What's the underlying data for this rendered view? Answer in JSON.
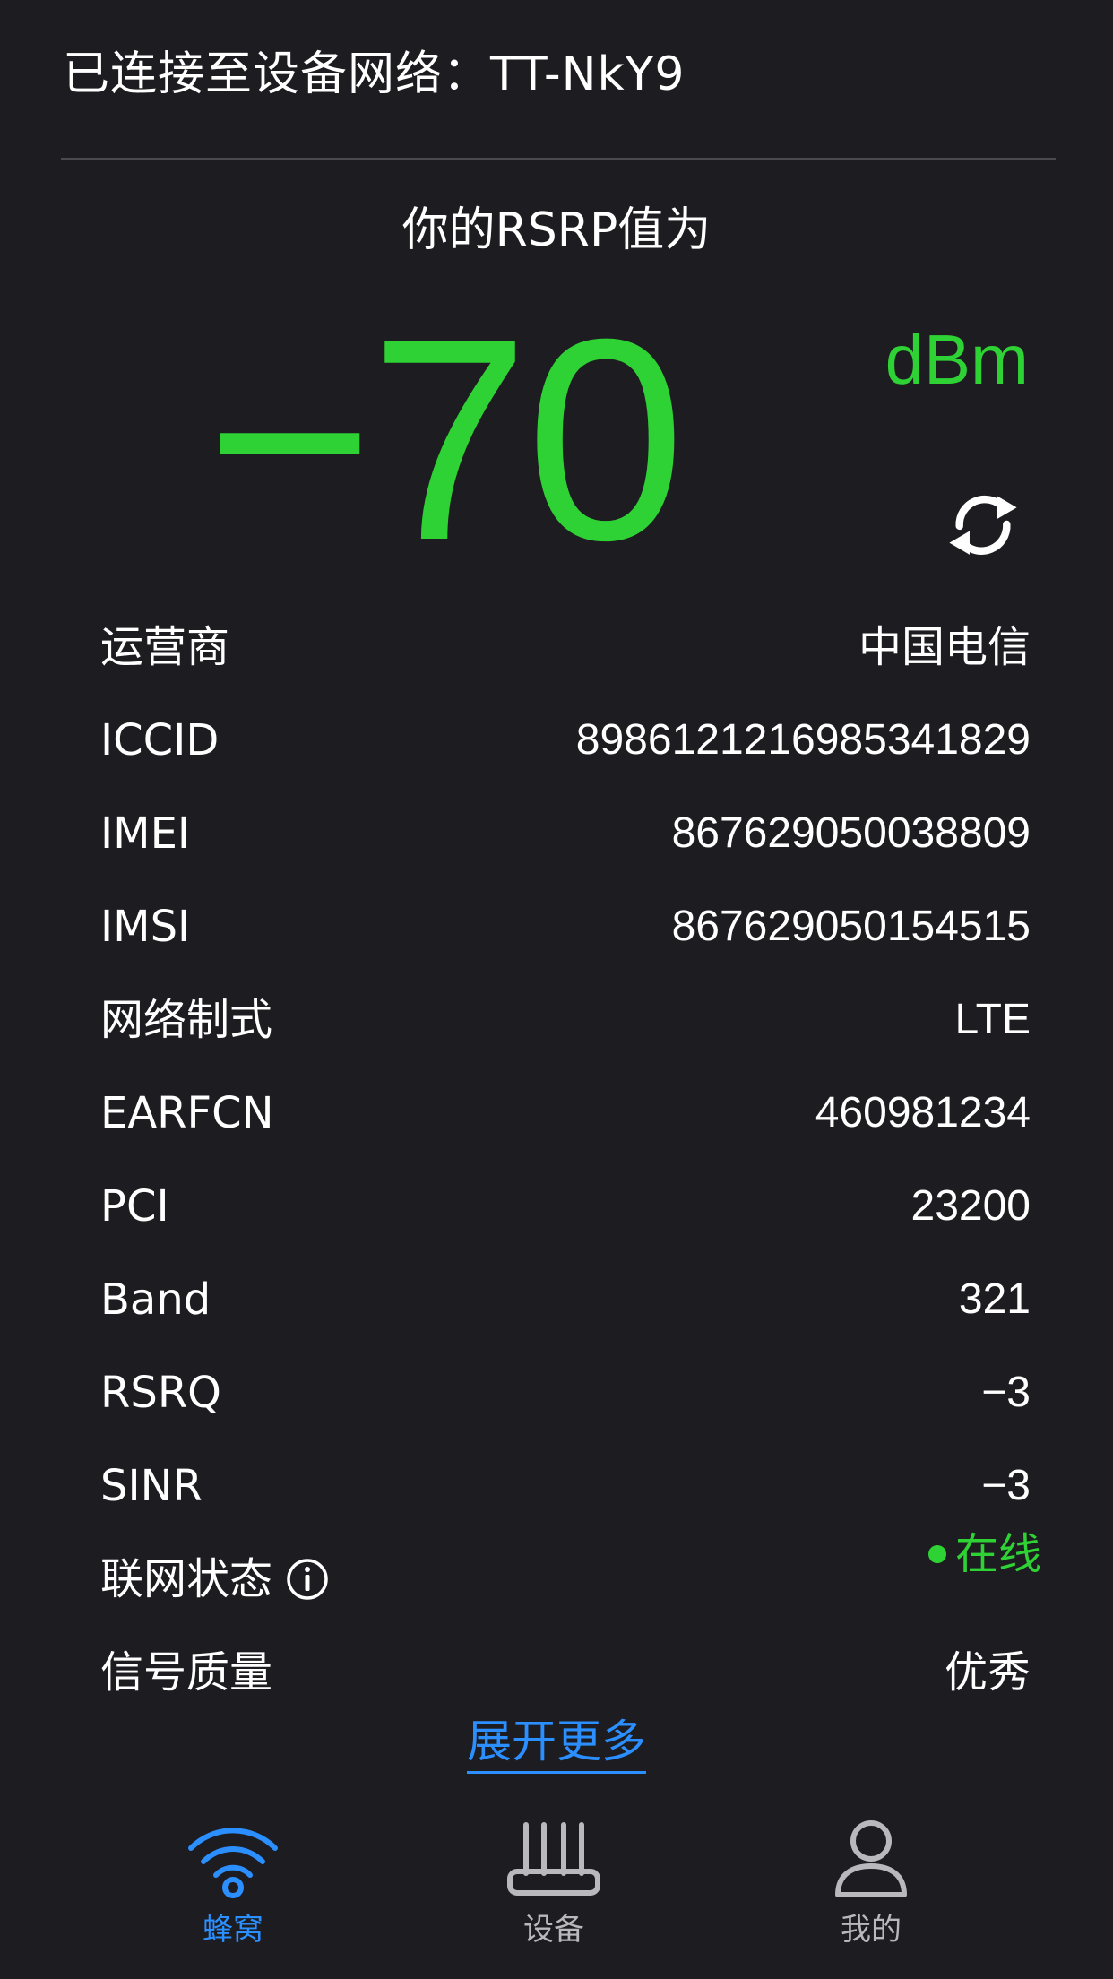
{
  "header": {
    "title": "已连接至设备网络：TT-NkY9"
  },
  "rsrp": {
    "label": "你的RSRP值为",
    "value": "−70",
    "unit": "dBm",
    "refresh_icon": "refresh-icon"
  },
  "info_rows": [
    {
      "label": "运营商",
      "value": "中国电信"
    },
    {
      "label": "ICCID",
      "value": "89861212169853418​29"
    },
    {
      "label": "IMEI",
      "value": "867629050038809"
    },
    {
      "label": "IMSI",
      "value": "867629050154515"
    },
    {
      "label": "网络制式",
      "value": "LTE"
    },
    {
      "label": "EARFCN",
      "value": "460981234"
    },
    {
      "label": "PCI",
      "value": "23200"
    },
    {
      "label": "Band",
      "value": "321"
    },
    {
      "label": "RSRQ",
      "value": "−3"
    },
    {
      "label": "SINR",
      "value": "−3"
    },
    {
      "label": "联网状态",
      "value": "在线"
    },
    {
      "label": "信号质量",
      "value": "优秀"
    }
  ],
  "expand_link": "展开更多",
  "tabs": [
    {
      "label": "蜂窝",
      "icon": "wifi-icon",
      "active": true
    },
    {
      "label": "设备",
      "icon": "router-icon",
      "active": false
    },
    {
      "label": "我的",
      "icon": "user-icon",
      "active": false
    }
  ],
  "colors": {
    "background": "#1c1c21",
    "accent_green": "#2fd234",
    "accent_blue": "#2b8fff",
    "text": "#ffffff",
    "inactive": "#b8b8bd"
  }
}
